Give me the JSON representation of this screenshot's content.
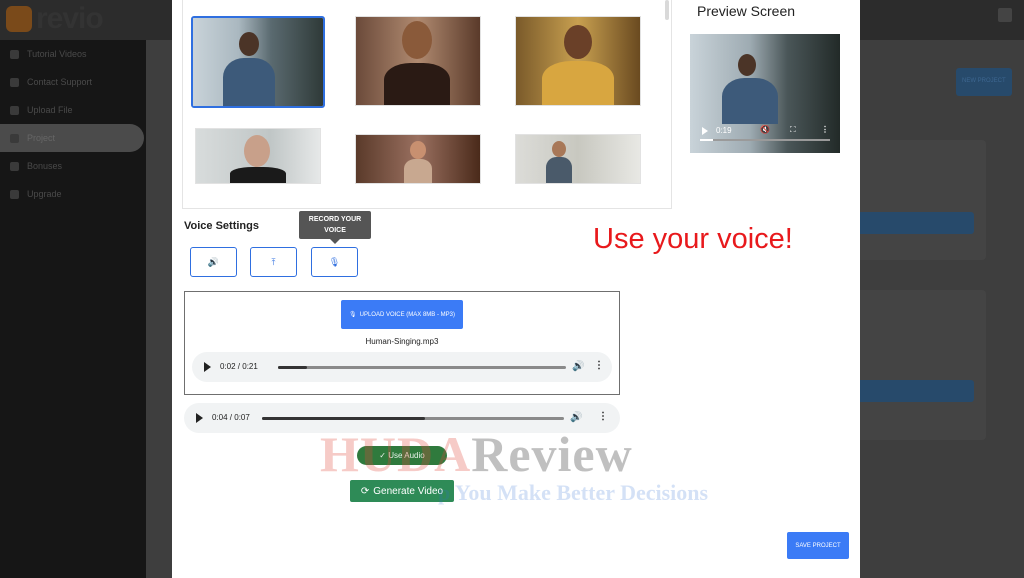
{
  "background_app": {
    "logo": "revio",
    "sidebar": [
      {
        "label": "Tutorial Videos"
      },
      {
        "label": "Contact Support"
      },
      {
        "label": "Upload File"
      },
      {
        "label": "Project",
        "active": true
      },
      {
        "label": "Bonuses"
      },
      {
        "label": "Upgrade"
      }
    ],
    "top_right_button": "NEW PROJECT"
  },
  "modal": {
    "grid": {
      "thumbnails": [
        {
          "name": "thumb-1",
          "selected": true
        },
        {
          "name": "thumb-2"
        },
        {
          "name": "thumb-3"
        },
        {
          "name": "thumb-4"
        },
        {
          "name": "thumb-5"
        },
        {
          "name": "thumb-6"
        }
      ]
    },
    "voice_settings": {
      "title": "Voice Settings",
      "tooltip": "RECORD YOUR VOICE",
      "buttons": [
        {
          "name": "speaker-icon",
          "glyph": "🔊"
        },
        {
          "name": "upload-icon",
          "glyph": "⤒"
        },
        {
          "name": "microphone-icon",
          "glyph": "🎙"
        }
      ]
    },
    "upload": {
      "button_label": "UPLOAD VOICE (MAX 8MB - MP3)",
      "file_name": "Human-Singing.mp3",
      "player_time": "0:02 / 0:21",
      "progress": 0.1
    },
    "second_player": {
      "time": "0:04 / 0:07",
      "progress": 0.54
    },
    "use_audio": "✓ Use Audio",
    "generate": "Generate Video",
    "preview": {
      "title": "Preview Screen",
      "time": "0:19",
      "progress": 0.1
    },
    "annotation": "Use your voice!",
    "save_button": "SAVE PROJECT"
  },
  "watermark": {
    "part1": "HUDA",
    "part2": "Review",
    "tagline": "p You Make Better Decisions"
  },
  "colors": {
    "primary_blue": "#3b7bf6",
    "green": "#2e8b57",
    "annotation_red": "#e8191c"
  }
}
